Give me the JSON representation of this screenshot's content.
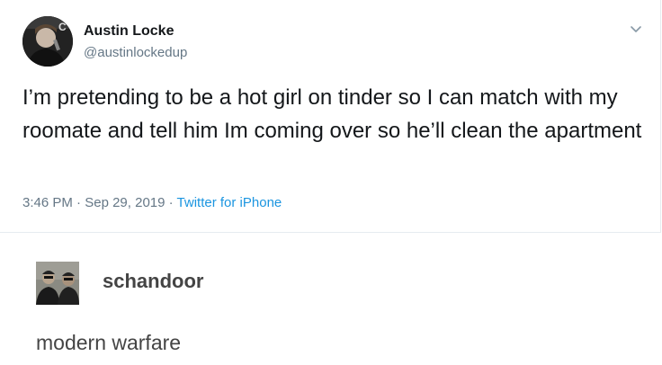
{
  "tweet": {
    "author_name": "Austin Locke",
    "author_handle": "@austinlockedup",
    "text": "I’m pretending to be a hot girl on tinder so I can match with my roomate and tell him Im coming over so he’ll clean the apartment",
    "time": "3:46 PM",
    "date": "Sep 29, 2019",
    "separator": "·",
    "source": "Twitter for iPhone",
    "menu_icon": "chevron-down-icon"
  },
  "reblog": {
    "username": "schandoor",
    "body": "modern warfare"
  },
  "colors": {
    "link": "#1b95e0",
    "secondary_text": "#657786",
    "primary_text": "#14171a",
    "post_text": "#444444",
    "divider": "#e6ecf0"
  }
}
